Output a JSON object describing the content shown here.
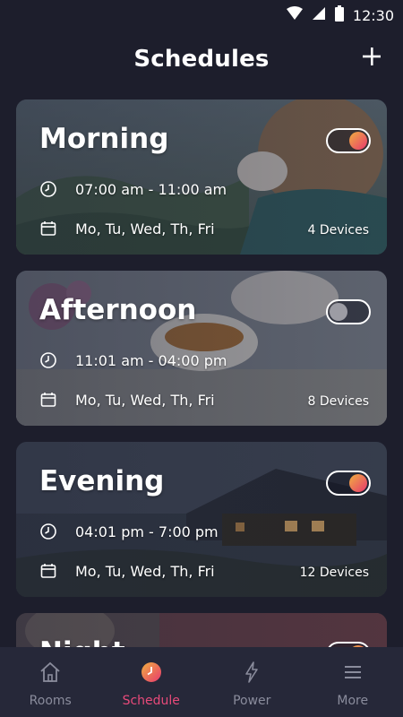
{
  "status_bar": {
    "time": "12:30"
  },
  "header": {
    "title": "Schedules",
    "add_icon": "plus-icon"
  },
  "schedules": [
    {
      "title": "Morning",
      "time": "07:00 am - 11:00 am",
      "days": "Mo, Tu, Wed, Th, Fri",
      "devices": "4 Devices",
      "enabled": true
    },
    {
      "title": "Afternoon",
      "time": "11:01 am - 04:00 pm",
      "days": "Mo, Tu, Wed, Th, Fri",
      "devices": "8 Devices",
      "enabled": false
    },
    {
      "title": "Evening",
      "time": "04:01 pm - 7:00 pm",
      "days": "Mo, Tu, Wed, Th, Fri",
      "devices": "12 Devices",
      "enabled": true
    },
    {
      "title": "Night",
      "enabled": true
    }
  ],
  "bottom_nav": [
    {
      "label": "Rooms",
      "icon": "home-icon",
      "active": false
    },
    {
      "label": "Schedule",
      "icon": "clock-icon",
      "active": true
    },
    {
      "label": "Power",
      "icon": "lightning-icon",
      "active": false
    },
    {
      "label": "More",
      "icon": "menu-icon",
      "active": false
    }
  ],
  "colors": {
    "background": "#1d1e2c",
    "accent_pink": "#e84a7a",
    "accent_orange": "#f0b040",
    "nav_background": "#262839"
  }
}
